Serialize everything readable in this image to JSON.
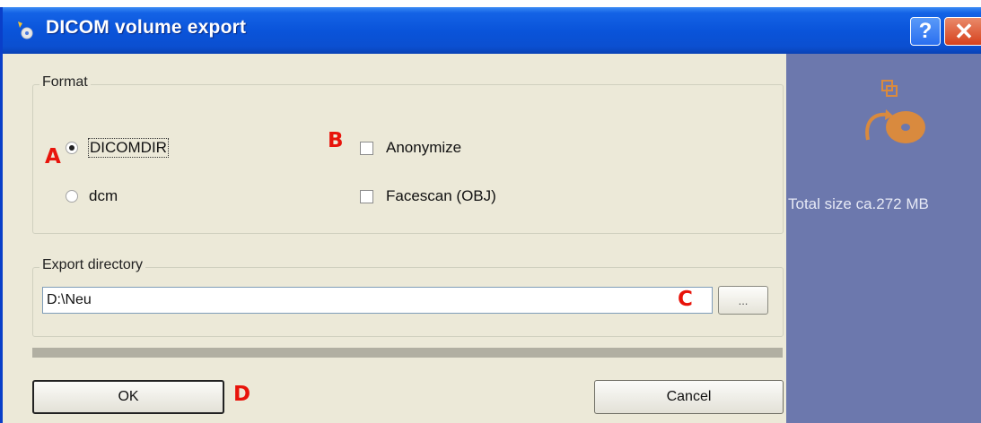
{
  "window": {
    "title": "DICOM volume export"
  },
  "titlebar_buttons": {
    "help": "?",
    "close": "✕"
  },
  "format_group": {
    "title": "Format",
    "radios": [
      {
        "label": "DICOMDIR",
        "selected": true
      },
      {
        "label": "dcm",
        "selected": false
      }
    ],
    "checkboxes": [
      {
        "label": "Anonymize",
        "checked": false
      },
      {
        "label": "Facescan (OBJ)",
        "checked": false
      }
    ]
  },
  "export_group": {
    "title": "Export directory",
    "path_value": "D:\\Neu",
    "browse_label": "..."
  },
  "side_panel": {
    "total_size": "Total size ca.272 MB"
  },
  "buttons": {
    "ok": "OK",
    "cancel": "Cancel"
  },
  "annotations": {
    "a": "A",
    "b": "B",
    "c": "C",
    "d": "D"
  },
  "colors": {
    "titlebar": "#0a54da",
    "side_panel": "#6c78ad",
    "dialog_bg": "#ece9d8",
    "marker": "#e8140b",
    "icon": "#d98a3e"
  }
}
